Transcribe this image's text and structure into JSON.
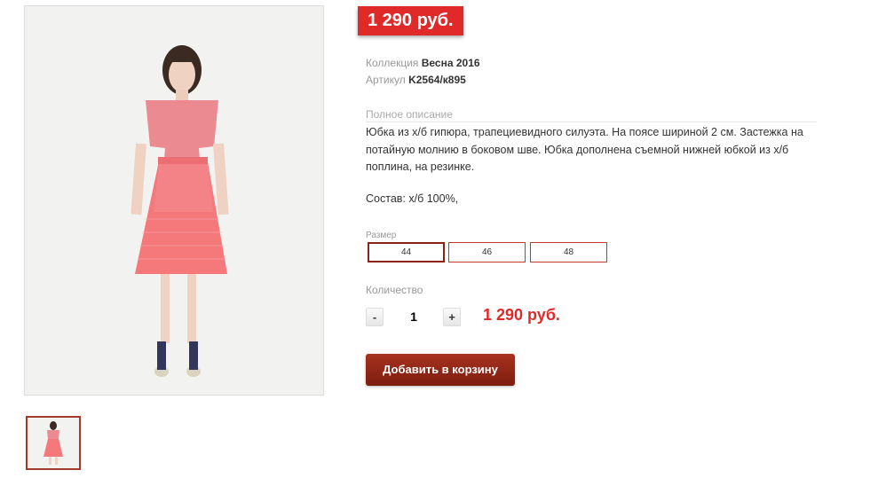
{
  "product": {
    "price_badge": "1 290 руб.",
    "collection_label": "Коллекция",
    "collection_value": "Весна 2016",
    "article_label": "Артикул",
    "article_value": "K2564/к895",
    "description_label": "Полное описание",
    "description": "Юбка из х/б гипюра, трапециевидного силуэта. На поясе шириной 2 см. Застежка на потайную молнию в боковом шве. Юбка дополнена съемной нижней юбкой из х/б поплина, на резинке.",
    "composition": "Состав: х/б 100%,",
    "size_label": "Размер",
    "sizes": [
      "44",
      "46",
      "48"
    ],
    "selected_size": "44",
    "quantity_label": "Количество",
    "qty_minus": "-",
    "qty_plus": "+",
    "quantity": "1",
    "total_price": "1 290 руб.",
    "add_to_cart": "Добавить в корзину"
  },
  "colors": {
    "accent_red": "#e02a2a",
    "button_dark_red": "#8b2416",
    "dress_pink": "#f07c80"
  }
}
